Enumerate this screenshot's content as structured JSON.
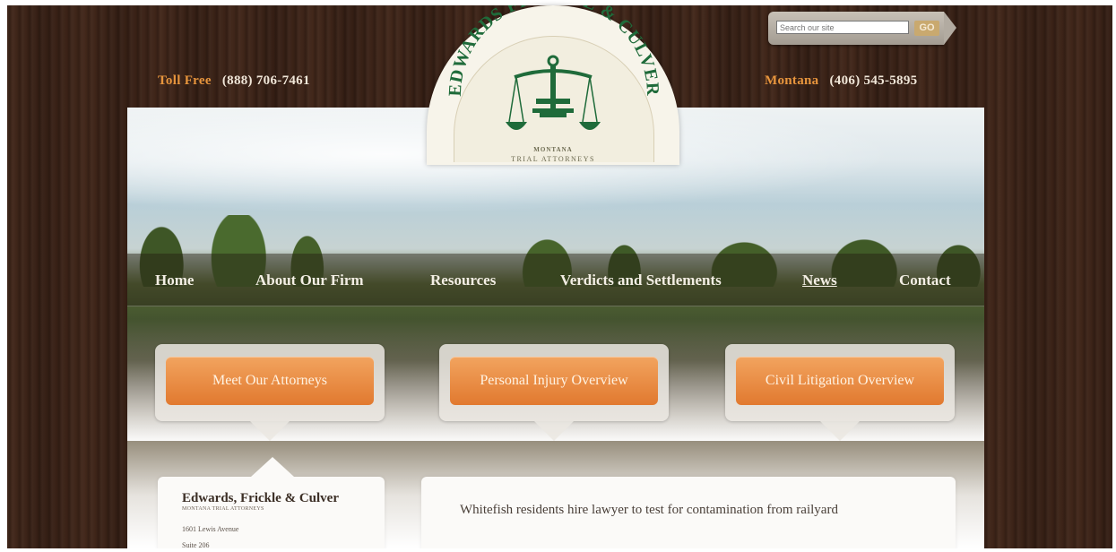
{
  "header": {
    "toll_free_label": "Toll Free",
    "toll_free_number": "(888) 706-7461",
    "montana_label": "Montana",
    "montana_number": "(406) 545-5895"
  },
  "logo": {
    "firm_arc_text": "EDWARDS FRICKLE & CULVER",
    "tagline_1": "MONTANA",
    "tagline_2": "TRIAL ATTORNEYS",
    "icon": "scales-of-justice-icon"
  },
  "search": {
    "placeholder": "Search our site",
    "button_label": "GO"
  },
  "nav": {
    "items": [
      "Home",
      "About Our Firm",
      "Resources",
      "Verdicts and Settlements",
      "News",
      "Contact"
    ],
    "active": "News"
  },
  "callouts": [
    "Meet Our Attorneys",
    "Personal Injury Overview",
    "Civil Litigation Overview"
  ],
  "sidebar": {
    "firm_name": "Edwards, Frickle & Culver",
    "firm_subtitle": "MONTANA TRIAL ATTORNEYS",
    "address_line_1": "1601 Lewis Avenue",
    "address_line_2": "Suite 206"
  },
  "news": {
    "headline": "Whitefish residents hire lawyer to test for contamination from railyard"
  },
  "colors": {
    "accent_orange": "#e7953d",
    "button_orange": "#e1792f",
    "logo_green": "#1f6b3a",
    "wood_brown": "#3a2217"
  }
}
